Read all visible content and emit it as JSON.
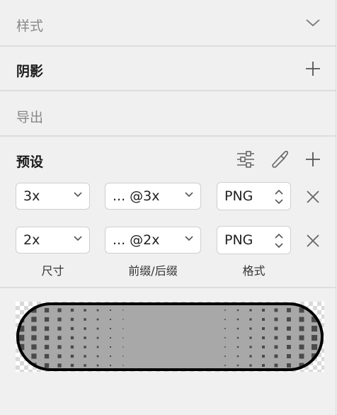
{
  "panel": {
    "style_section": {
      "title": "样式",
      "icon": "chevron-down-icon"
    },
    "shadow_section": {
      "title": "阴影",
      "icon": "plus-icon"
    },
    "export_section": {
      "title": "导出"
    },
    "presets": {
      "title": "预设",
      "icons": [
        "sliders-icon",
        "knife-icon",
        "plus-icon"
      ],
      "rows": [
        {
          "size": "3x",
          "suffix": "... @3x",
          "format": "PNG"
        },
        {
          "size": "2x",
          "suffix": "... @2x",
          "format": "PNG"
        }
      ],
      "captions": {
        "size": "尺寸",
        "suffix": "前缀/后缀",
        "format": "格式"
      }
    },
    "preview": {
      "stroke_color": "#000000",
      "fill_color": "#a8a8a8",
      "dot_color": "#4a4a4a"
    }
  }
}
